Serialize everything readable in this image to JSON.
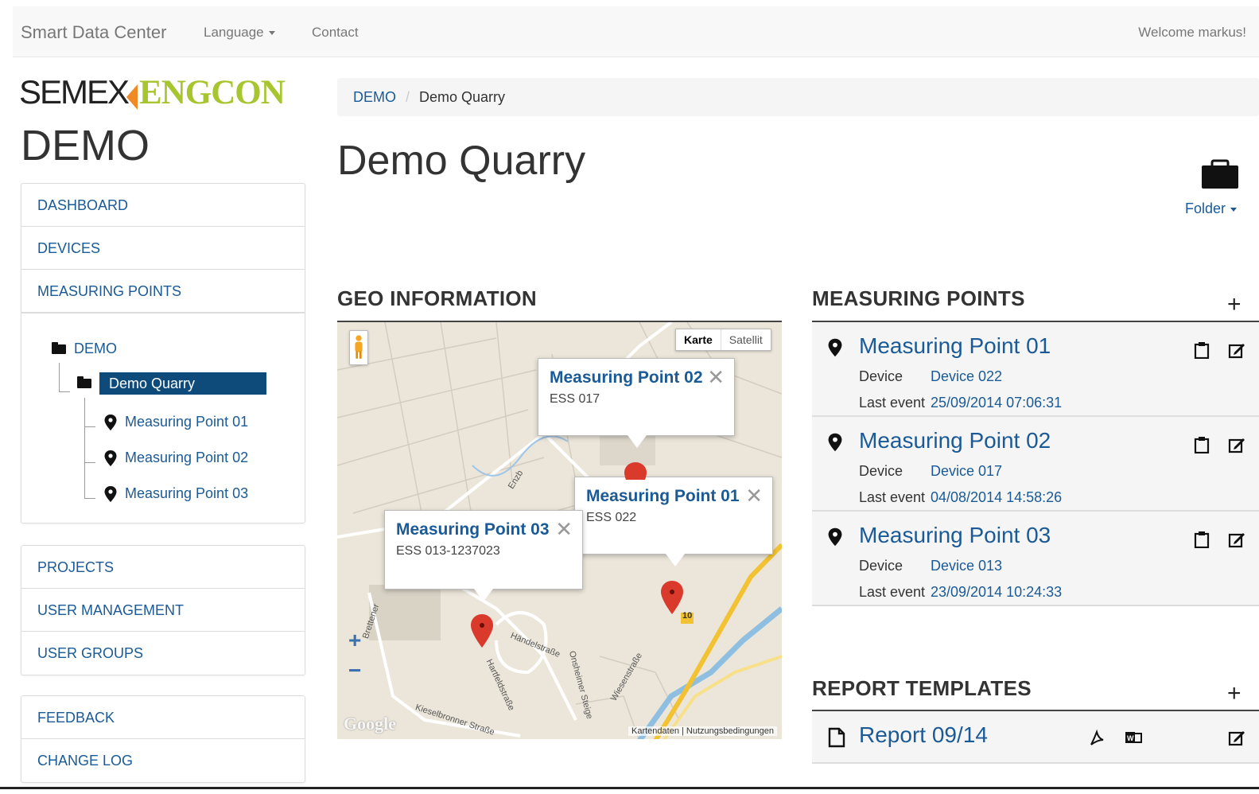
{
  "navbar": {
    "brand": "Smart Data Center",
    "language": "Language",
    "contact": "Contact",
    "welcome": "Welcome markus!"
  },
  "logo": {
    "part1": "SEMEX",
    "part2": "ENGCON"
  },
  "org_title": "DEMO",
  "sidebar": {
    "main": [
      "DASHBOARD",
      "DEVICES",
      "MEASURING POINTS"
    ],
    "tree": {
      "root": "DEMO",
      "selected": "Demo Quarry",
      "children": [
        "Measuring Point 01",
        "Measuring Point 02",
        "Measuring Point 03"
      ]
    },
    "admin": [
      "PROJECTS",
      "USER MANAGEMENT",
      "USER GROUPS"
    ],
    "misc": [
      "FEEDBACK",
      "CHANGE LOG"
    ]
  },
  "breadcrumb": {
    "root": "DEMO",
    "separator": "/",
    "current": "Demo Quarry"
  },
  "page_title": "Demo Quarry",
  "folder_menu": "Folder",
  "geo": {
    "title": "GEO INFORMATION",
    "map_type": {
      "map": "Karte",
      "satellite": "Satellit"
    },
    "zoom_in": "+",
    "zoom_out": "−",
    "attribution": "Kartendaten | Nutzungsbedingungen",
    "google": "Google",
    "road_number": "10",
    "streets": [
      "Händelstraße",
      "Hartfeldstraße",
      "Kieselbronner Straße",
      "Wiesenstraße",
      "Onsheimer Steige",
      "Brettener",
      "Enzb"
    ],
    "info_windows": [
      {
        "title": "Measuring Point 02",
        "subtitle": "ESS 017",
        "close": "✕"
      },
      {
        "title": "Measuring Point 01",
        "subtitle": "ESS 022",
        "close": "✕"
      },
      {
        "title": "Measuring Point 03",
        "subtitle": "ESS 013-1237023",
        "close": "✕"
      }
    ]
  },
  "measuring_points": {
    "title": "MEASURING POINTS",
    "add": "+",
    "device_label": "Device",
    "last_event_label": "Last event",
    "items": [
      {
        "name": "Measuring Point 01",
        "device": "Device 022",
        "last_event": "25/09/2014 07:06:31"
      },
      {
        "name": "Measuring Point 02",
        "device": "Device 017",
        "last_event": "04/08/2014 14:58:26"
      },
      {
        "name": "Measuring Point 03",
        "device": "Device 013",
        "last_event": "23/09/2014 10:24:33"
      }
    ]
  },
  "report_templates": {
    "title": "REPORT TEMPLATES",
    "add": "+",
    "items": [
      {
        "name": "Report 09/14"
      }
    ]
  },
  "colors": {
    "link": "#1a5a96",
    "selected": "#0e4a7a",
    "logo_green": "#a6c52f",
    "logo_orange": "#f08a24",
    "marker": "#d93a2b"
  }
}
